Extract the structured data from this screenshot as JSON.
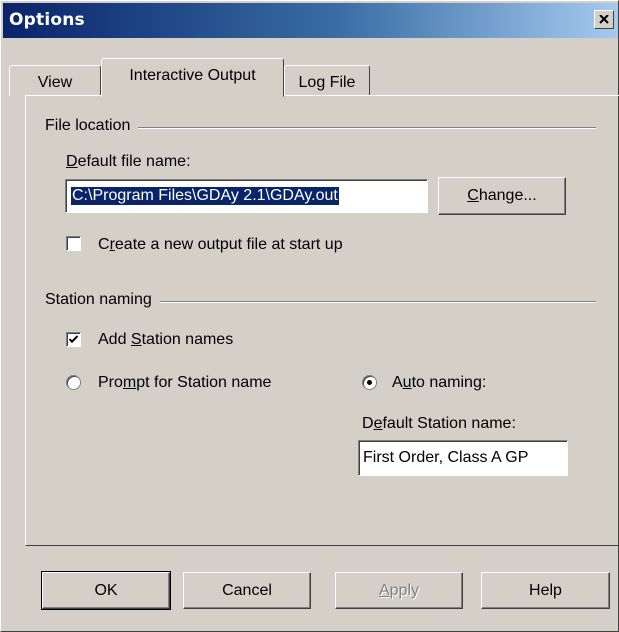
{
  "window": {
    "title": "Options"
  },
  "tabs": [
    {
      "label": "View",
      "active": false
    },
    {
      "label": "Interactive Output",
      "active": true
    },
    {
      "label": "Log File",
      "active": false
    }
  ],
  "file_location": {
    "group_label": "File location",
    "default_file_label_mnemonic": "D",
    "default_file_label_rest": "efault file name:",
    "file_path": "C:\\Program Files\\GDAy 2.1\\GDAy.out",
    "change_button_mnemonic": "C",
    "change_button_rest": "hange...",
    "create_new_checkbox": {
      "pre": "C",
      "mnemonic": "r",
      "post": "eate a new output file at start up",
      "checked": false
    }
  },
  "station_naming": {
    "group_label": "Station naming",
    "add_names_checkbox": {
      "pre": "Add ",
      "mnemonic": "S",
      "post": "tation names",
      "checked": true
    },
    "prompt_radio": {
      "pre": "Pro",
      "mnemonic": "m",
      "post": "pt for Station name",
      "selected": false
    },
    "auto_radio": {
      "pre": "A",
      "mnemonic": "u",
      "post": "to naming:",
      "selected": true
    },
    "default_station_label_pre": "D",
    "default_station_label_mnemonic": "e",
    "default_station_label_post": "fault Station name:",
    "default_station_value": "First Order, Class A GP"
  },
  "footer_buttons": {
    "ok": "OK",
    "cancel": "Cancel",
    "apply_mnemonic": "A",
    "apply_rest": "pply",
    "help": "Help"
  },
  "colors": {
    "face": "#d4d0c8",
    "title_start": "#0a246a",
    "title_end": "#a6caf0",
    "selection": "#0a246a"
  }
}
